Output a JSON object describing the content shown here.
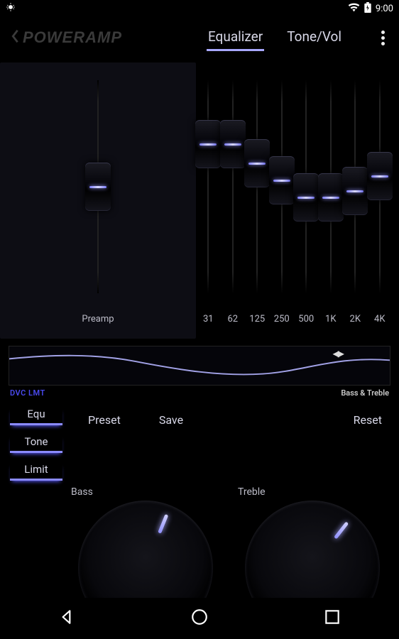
{
  "status": {
    "time": "9:00"
  },
  "header": {
    "logo": "POWERAMP",
    "tabs": [
      "Equalizer",
      "Tone/Vol"
    ],
    "active_tab": 0
  },
  "eq": {
    "preamp_label": "Preamp",
    "preamp_value": 50,
    "bands": [
      {
        "label": "31",
        "value": 70
      },
      {
        "label": "62",
        "value": 70
      },
      {
        "label": "125",
        "value": 61
      },
      {
        "label": "250",
        "value": 53
      },
      {
        "label": "500",
        "value": 45
      },
      {
        "label": "1K",
        "value": 45
      },
      {
        "label": "2K",
        "value": 48
      },
      {
        "label": "4K",
        "value": 55
      }
    ]
  },
  "curve": {
    "dvc_lmt": "DVC LMT",
    "bass_treble": "Bass & Treble"
  },
  "toggles": {
    "equ": "Equ",
    "tone": "Tone",
    "limit": "Limit"
  },
  "actions": {
    "preset": "Preset",
    "save": "Save",
    "reset": "Reset"
  },
  "knobs": {
    "bass_label": "Bass",
    "treble_label": "Treble"
  }
}
